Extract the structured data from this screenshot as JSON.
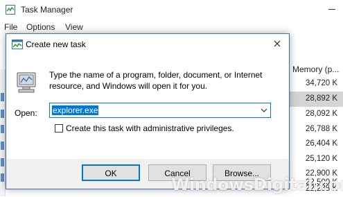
{
  "task_manager": {
    "title": "Task Manager",
    "menu": [
      "File",
      "Options",
      "View"
    ],
    "column_header": "Memory (p...",
    "rows": [
      "34,720 K",
      "28,892 K",
      "28,092 K",
      "26,788 K",
      "26,404 K",
      "25,120 K",
      "22,900 K",
      "22,500 K",
      "22,288 K"
    ],
    "selected_row_index": 1
  },
  "dialog": {
    "title": "Create new task",
    "message": "Type the name of a program, folder, document, or Internet resource, and Windows will open it for you.",
    "open_label": "Open:",
    "open_value": "explorer.exe",
    "checkbox_label": "Create this task with administrative privileges.",
    "checkbox_checked": false,
    "buttons": {
      "ok": "OK",
      "cancel": "Cancel",
      "browse": "Browse..."
    }
  },
  "watermark": "WindowsDigital.com",
  "colors": {
    "accent": "#0078d7",
    "selection_row": "#d4d4d4",
    "footer_bg": "#f0f0f0"
  }
}
